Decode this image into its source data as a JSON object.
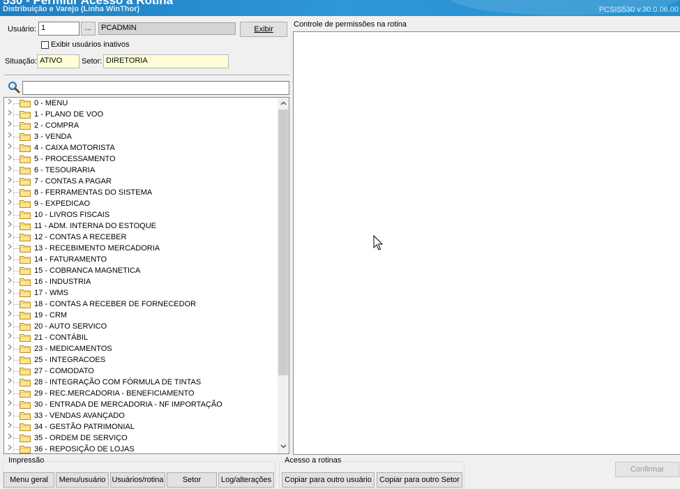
{
  "window": {
    "title": "530 - Permitir Acesso a Rotina",
    "subtitle": "Distribuição e Varejo (Linha WinThor)",
    "version": "PCSIS530  v.30.0.06.00"
  },
  "user": {
    "label": "Usuário:",
    "code": "1",
    "browse_label": "...",
    "name": "PCADMIN",
    "show_button": "Exibir",
    "inactive_checkbox_label": "Exibir usuários inativos",
    "inactive_checked": false,
    "status_label": "Situação:",
    "status_value": "ATIVO",
    "sector_label": "Setor:",
    "sector_value": "DIRETORIA"
  },
  "search": {
    "icon": "search-icon",
    "value": ""
  },
  "tree": {
    "items": [
      "0 - MENU",
      "1 - PLANO DE VOO",
      "2 - COMPRA",
      "3 - VENDA",
      "4 - CAIXA MOTORISTA",
      "5 - PROCESSAMENTO",
      "6 - TESOURARIA",
      "7 - CONTAS A PAGAR",
      "8 - FERRAMENTAS DO SISTEMA",
      "9 - EXPEDICAO",
      "10 - LIVROS FISCAIS",
      "11 - ADM. INTERNA DO ESTOQUE",
      "12 - CONTAS A RECEBER",
      "13 - RECEBIMENTO MERCADORIA",
      "14 - FATURAMENTO",
      "15 - COBRANCA MAGNETICA",
      "16 - INDUSTRIA",
      "17 - WMS",
      "18 - CONTAS A RECEBER DE FORNECEDOR",
      "19 - CRM",
      "20 - AUTO SERVICO",
      "21 - CONTÁBIL",
      "23 - MEDICAMENTOS",
      "25 - INTEGRACOES",
      "27 - COMODATO",
      "28 - INTEGRAÇÃO COM FÓRMULA DE TINTAS",
      "29 - REC.MERCADORIA - BENEFICIAMENTO",
      "30 - ENTRADA DE MERCADORIA - NF IMPORTAÇÃO",
      "33 - VENDAS AVANÇADO",
      "34 - GESTÃO PATRIMONIAL",
      "35 - ORDEM DE SERVIÇO",
      "36 - REPOSIÇÃO DE LOJAS"
    ]
  },
  "permissions": {
    "title": "Controle de permissões na rotina"
  },
  "print_group": {
    "title": "Impressão",
    "buttons": [
      "Menu geral",
      "Menu/usuário",
      "Usuários/rotina",
      "Setor",
      "Log/alterações"
    ]
  },
  "access_group": {
    "title": "Acesso a rotinas",
    "buttons": [
      "Copiar para outro usuário",
      "Copiar para outro Setor"
    ]
  },
  "confirm_label": "Confirmar"
}
